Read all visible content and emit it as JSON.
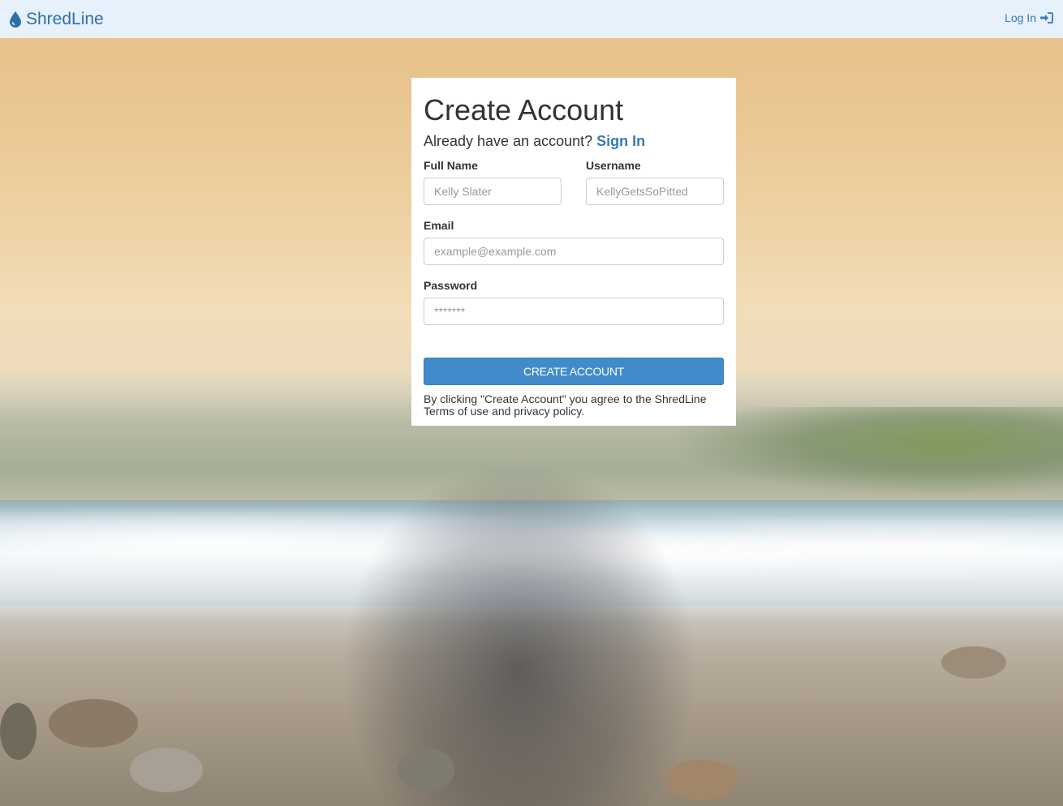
{
  "navbar": {
    "brand": "ShredLine",
    "brand_icon": "water-drop-icon",
    "login_label": "Log In",
    "login_icon": "sign-in-icon",
    "accent": "#2f6fa6"
  },
  "form": {
    "title": "Create Account",
    "subtitle_prefix": "Already have an account?",
    "signin_link": "Sign In",
    "fields": {
      "full_name": {
        "label": "Full Name",
        "placeholder": "Kelly Slater"
      },
      "username": {
        "label": "Username",
        "placeholder": "KellyGetsSoPitted"
      },
      "email": {
        "label": "Email",
        "placeholder": "example@example.com"
      },
      "password": {
        "label": "Password",
        "placeholder": "*******"
      }
    },
    "submit_label": "CREATE ACCOUNT",
    "terms": "By clicking \"Create Account\" you agree to the ShredLine Terms of use and privacy policy.",
    "button_color": "#428bca",
    "link_color": "#337ab7"
  }
}
